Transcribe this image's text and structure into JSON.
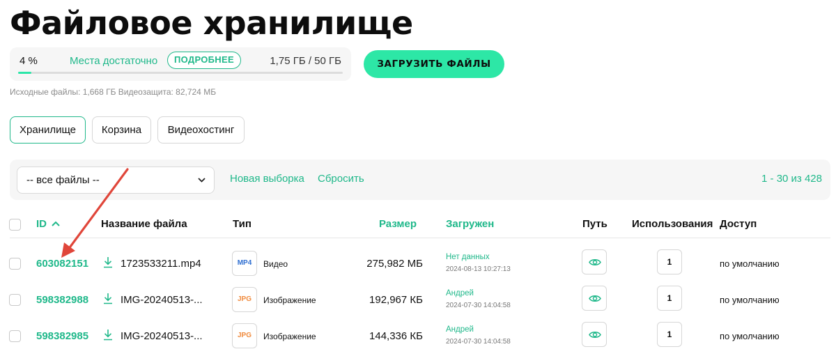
{
  "page": {
    "title": "Файловое хранилище"
  },
  "storage": {
    "percent_text": "4 %",
    "percent": 4,
    "status": "Места достаточно",
    "more_label": "ПОДРОБНЕЕ",
    "used": "1,75 ГБ / 50 ГБ",
    "sources_note": "Исходные файлы: 1,668 ГБ Видеозащита: 82,724 МБ"
  },
  "upload_button": {
    "label": "ЗАГРУЗИТЬ ФАЙЛЫ"
  },
  "tabs": [
    {
      "label": "Хранилище",
      "active": true
    },
    {
      "label": "Корзина",
      "active": false
    },
    {
      "label": "Видеохостинг",
      "active": false
    }
  ],
  "filters": {
    "select_value": "-- все файлы --",
    "new_selection": "Новая выборка",
    "reset": "Сбросить",
    "pagination": "1 - 30 из 428"
  },
  "table": {
    "columns": {
      "id": "ID",
      "name": "Название файла",
      "type": "Тип",
      "size": "Размер",
      "uploaded": "Загружен",
      "path": "Путь",
      "uses": "Использования",
      "access": "Доступ"
    },
    "rows": [
      {
        "id": "603082151",
        "name": "1723533211.mp4",
        "badge": "MP4",
        "type": "Видео",
        "size": "275,982 МБ",
        "uploader": "Нет данных",
        "date": "2024-08-13 10:27:13",
        "uses": "1",
        "access": "по умолчанию"
      },
      {
        "id": "598382988",
        "name": "IMG-20240513-...",
        "badge": "JPG",
        "type": "Изображение",
        "size": "192,967 КБ",
        "uploader": "Андрей",
        "date": "2024-07-30 14:04:58",
        "uses": "1",
        "access": "по умолчанию"
      },
      {
        "id": "598382985",
        "name": "IMG-20240513-...",
        "badge": "JPG",
        "type": "Изображение",
        "size": "144,336 КБ",
        "uploader": "Андрей",
        "date": "2024-07-30 14:04:58",
        "uses": "1",
        "access": "по умолчанию"
      }
    ]
  },
  "colors": {
    "accent": "#1fb88a",
    "button": "#2de7a6",
    "arrow": "#e0463a",
    "mp4": "#2f6fd1",
    "jpg": "#f08a3c"
  },
  "icons": {
    "sort": "chevron-up-icon",
    "download": "download-icon",
    "path": "eye-icon",
    "select": "chevron-down-icon",
    "annotation": "arrow-icon"
  }
}
